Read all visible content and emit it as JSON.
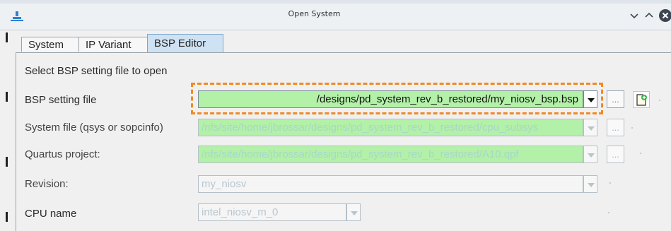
{
  "window": {
    "title": "Open System",
    "app_icon": "nios-app-icon",
    "controls": [
      "minimize-icon",
      "maximize-icon",
      "close-icon"
    ]
  },
  "tabs": [
    {
      "label": "System",
      "active": false
    },
    {
      "label": "IP Variant",
      "active": false
    },
    {
      "label": "BSP Editor",
      "active": true
    }
  ],
  "form": {
    "instruction": "Select BSP setting file to open",
    "bsp_setting_file": {
      "label": "BSP setting file",
      "value": "/designs/pd_system_rev_b_restored/my_niosv_bsp.bsp",
      "browse_label": "..."
    },
    "system_file": {
      "label": "System file (qsys or sopcinfo)",
      "value": "/nfs/site/home/jbrossar/designs/pd_system_rev_b_restored/cpu_subsys",
      "browse_label": "..."
    },
    "quartus_project": {
      "label": "Quartus project:",
      "value": "/nfs/site/home/jbrossar/designs/pd_system_rev_b_restored/A10.qpf",
      "browse_label": "..."
    },
    "revision": {
      "label": "Revision:",
      "value": "my_niosv"
    },
    "cpu_name": {
      "label": "CPU name",
      "value": "intel_niosv_m_0"
    }
  },
  "colors": {
    "field_green": "#b3f0a8",
    "highlight": "#f08a24",
    "active_tab": "#cfe2f3"
  }
}
